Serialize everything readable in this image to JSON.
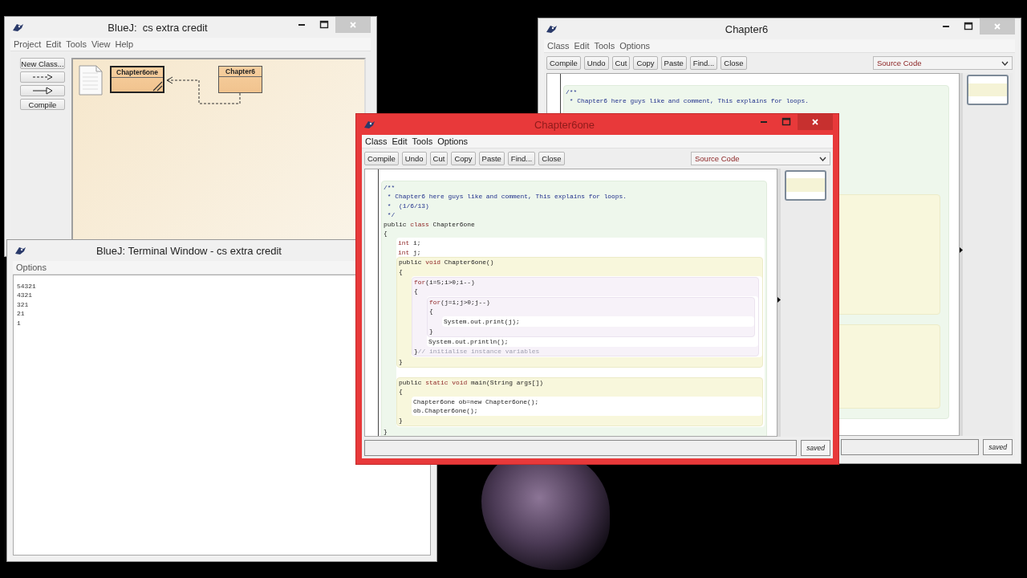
{
  "windows": [
    {
      "kind": "project",
      "title": "BlueJ:  cs extra credit",
      "active": false,
      "menus": [
        "Project",
        "Edit",
        "Tools",
        "View",
        "Help"
      ],
      "tools": [
        {
          "kind": "text",
          "label": "New Class..."
        },
        {
          "kind": "dashed-arrow"
        },
        {
          "kind": "solid-arrow"
        },
        {
          "kind": "text",
          "label": "Compile"
        }
      ],
      "classes": [
        {
          "name": "Chapter6one",
          "selected": true,
          "uncompiled": true
        },
        {
          "name": "Chapter6",
          "selected": false,
          "uncompiled": false
        }
      ]
    },
    {
      "kind": "terminal",
      "title": "BlueJ: Terminal Window - cs extra credit",
      "active": false,
      "menus": [
        "Options"
      ],
      "output": [
        "54321",
        "4321",
        "321",
        "21",
        "1"
      ]
    },
    {
      "kind": "editor",
      "title": "Chapter6one",
      "active": true,
      "menus": [
        "Class",
        "Edit",
        "Tools",
        "Options"
      ],
      "buttons": [
        "Compile",
        "Undo",
        "Cut",
        "Copy",
        "Paste",
        "Find...",
        "Close"
      ],
      "view": "Source Code",
      "status": "saved",
      "code": {
        "kind": "class",
        "items": [
          {
            "parts": [
              {
                "kind": "doc",
                "text": "/**"
              }
            ]
          },
          {
            "parts": [
              {
                "kind": "doc",
                "text": " * Chapter6 here guys like and comment, This explains for loops."
              }
            ]
          },
          {
            "parts": [
              {
                "kind": "doc",
                "text": " *  (1/6/13)"
              }
            ]
          },
          {
            "parts": [
              {
                "kind": "doc",
                "text": " */"
              }
            ]
          },
          {
            "parts": [
              {
                "kind": "plain",
                "text": "public "
              },
              {
                "kind": "keyword",
                "text": "class"
              },
              {
                "kind": "plain",
                "text": " Chapter6one"
              }
            ]
          },
          {
            "parts": [
              {
                "kind": "plain",
                "text": "{"
              }
            ]
          },
          {
            "kind": "body",
            "items": [
              {
                "parts": [
                  {
                    "kind": "keyword",
                    "text": "int"
                  },
                  {
                    "kind": "plain",
                    "text": " i;"
                  }
                ]
              },
              {
                "parts": [
                  {
                    "kind": "keyword",
                    "text": "int"
                  },
                  {
                    "kind": "plain",
                    "text": " j;"
                  }
                ]
              },
              {
                "kind": "method",
                "items": [
                  {
                    "parts": [
                      {
                        "kind": "plain",
                        "text": "public "
                      },
                      {
                        "kind": "keyword",
                        "text": "void"
                      },
                      {
                        "kind": "plain",
                        "text": " Chapter6one()"
                      }
                    ]
                  },
                  {
                    "parts": [
                      {
                        "kind": "plain",
                        "text": "{"
                      }
                    ]
                  },
                  {
                    "kind": "body",
                    "items": [
                      {
                        "kind": "loop",
                        "items": [
                          {
                            "parts": [
                              {
                                "kind": "keyword",
                                "text": "for"
                              },
                              {
                                "kind": "plain",
                                "text": "(i=5;i>0;i--)"
                              }
                            ]
                          },
                          {
                            "parts": [
                              {
                                "kind": "plain",
                                "text": "{"
                              }
                            ]
                          },
                          {
                            "kind": "body",
                            "items": [
                              {
                                "kind": "loop",
                                "items": [
                                  {
                                    "parts": [
                                      {
                                        "kind": "keyword",
                                        "text": "for"
                                      },
                                      {
                                        "kind": "plain",
                                        "text": "(j=i;j>0;j--)"
                                      }
                                    ]
                                  },
                                  {
                                    "parts": [
                                      {
                                        "kind": "plain",
                                        "text": "{"
                                      }
                                    ]
                                  },
                                  {
                                    "kind": "body",
                                    "items": [
                                      {
                                        "parts": [
                                          {
                                            "kind": "plain",
                                            "text": "System.out.print(j);"
                                          }
                                        ]
                                      }
                                    ]
                                  },
                                  {
                                    "parts": [
                                      {
                                        "kind": "plain",
                                        "text": "}"
                                      }
                                    ]
                                  }
                                ]
                              },
                              {
                                "parts": [
                                  {
                                    "kind": "plain",
                                    "text": "System.out.println();"
                                  }
                                ]
                              }
                            ]
                          },
                          {
                            "parts": [
                              {
                                "kind": "plain",
                                "text": "}"
                              },
                              {
                                "kind": "comment",
                                "text": "// initialise instance variables"
                              }
                            ]
                          }
                        ]
                      }
                    ]
                  },
                  {
                    "parts": [
                      {
                        "kind": "plain",
                        "text": "}"
                      }
                    ]
                  }
                ]
              },
              {
                "kind": "method",
                "items": [
                  {
                    "parts": [
                      {
                        "kind": "plain",
                        "text": "public "
                      },
                      {
                        "kind": "keyword",
                        "text": "static void"
                      },
                      {
                        "kind": "plain",
                        "text": " main(String args[])"
                      }
                    ]
                  },
                  {
                    "parts": [
                      {
                        "kind": "plain",
                        "text": "{"
                      }
                    ]
                  },
                  {
                    "kind": "body",
                    "items": [
                      {
                        "parts": [
                          {
                            "kind": "plain",
                            "text": "Chapter6one ob=new Chapter6one();"
                          }
                        ]
                      },
                      {
                        "parts": [
                          {
                            "kind": "plain",
                            "text": "ob.Chapter6one();"
                          }
                        ]
                      }
                    ]
                  },
                  {
                    "parts": [
                      {
                        "kind": "plain",
                        "text": "}"
                      }
                    ]
                  }
                ]
              }
            ]
          },
          {
            "parts": [
              {
                "kind": "plain",
                "text": "}"
              }
            ]
          }
        ]
      }
    },
    {
      "kind": "editor",
      "title": "Chapter6",
      "active": false,
      "menus": [
        "Class",
        "Edit",
        "Tools",
        "Options"
      ],
      "buttons": [
        "Compile",
        "Undo",
        "Cut",
        "Copy",
        "Paste",
        "Find...",
        "Close"
      ],
      "view": "Source Code",
      "status": "saved",
      "code": {
        "kind": "class",
        "items": [
          {
            "parts": [
              {
                "kind": "doc",
                "text": "/**"
              }
            ]
          },
          {
            "parts": [
              {
                "kind": "doc",
                "text": " * Chapter6 here guys like and comment, This explains for loops."
              }
            ]
          },
          {
            "kind": "method"
          },
          {
            "kind": "method"
          }
        ]
      }
    }
  ]
}
